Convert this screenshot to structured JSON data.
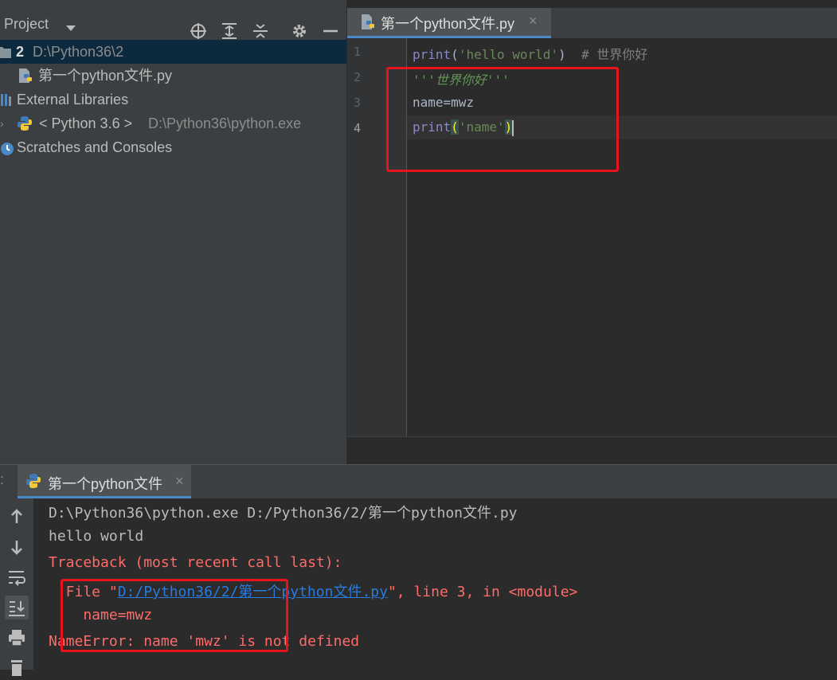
{
  "project_panel": {
    "title": "Project",
    "header_icons": [
      "locate-icon",
      "expand-all-icon",
      "collapse-all-icon",
      "gear-icon",
      "minimize-icon"
    ],
    "tree": [
      {
        "prefix": "2",
        "label": "D:\\Python36\\2",
        "icon": "folder-icon",
        "selected": true
      },
      {
        "label": "第一个python文件.py",
        "icon": "python-file-icon"
      },
      {
        "label": "External Libraries",
        "icon": "library-icon"
      },
      {
        "label": "< Python 3.6 >",
        "extra": "D:\\Python36\\python.exe",
        "icon": "python-icon"
      },
      {
        "label": "Scratches and Consoles",
        "icon": "scratches-icon"
      }
    ]
  },
  "editor": {
    "tab_label": "第一个python文件.py",
    "tab_close": "×",
    "line_numbers": [
      "1",
      "2",
      "3",
      "4"
    ],
    "code": {
      "line1": {
        "fn": "print",
        "open": "(",
        "str": "'hello world'",
        "close": ")",
        "comment": "  # 世界你好"
      },
      "line2": {
        "docstring": "'''世界你好'''"
      },
      "line3": {
        "text": "name=mwz"
      },
      "line4": {
        "fn": "print",
        "open": "(",
        "str": "'name'",
        "close": ")"
      }
    }
  },
  "run": {
    "tab_label": "第一个python文件",
    "tab_close": "×",
    "toolbar": [
      "up-arrow-icon",
      "down-arrow-icon",
      "soft-wrap-icon",
      "scroll-to-end-icon",
      "print-icon",
      "trash-icon"
    ],
    "console": {
      "cmd": "D:\\Python36\\python.exe D:/Python36/2/第一个python文件.py",
      "output": "hello world",
      "traceback": "Traceback (most recent call last):",
      "file_prefix": "  File \"",
      "file_link": "D:/Python36/2/第一个python文件.py",
      "file_suffix": "\", line 3, in <module>",
      "code_line": "    name=mwz",
      "error": "NameError: name 'mwz' is not defined"
    }
  },
  "colors": {
    "annotation": "#e8141b",
    "error_text": "#ff6b68",
    "link": "#287bde",
    "selection": "#0d293e"
  }
}
